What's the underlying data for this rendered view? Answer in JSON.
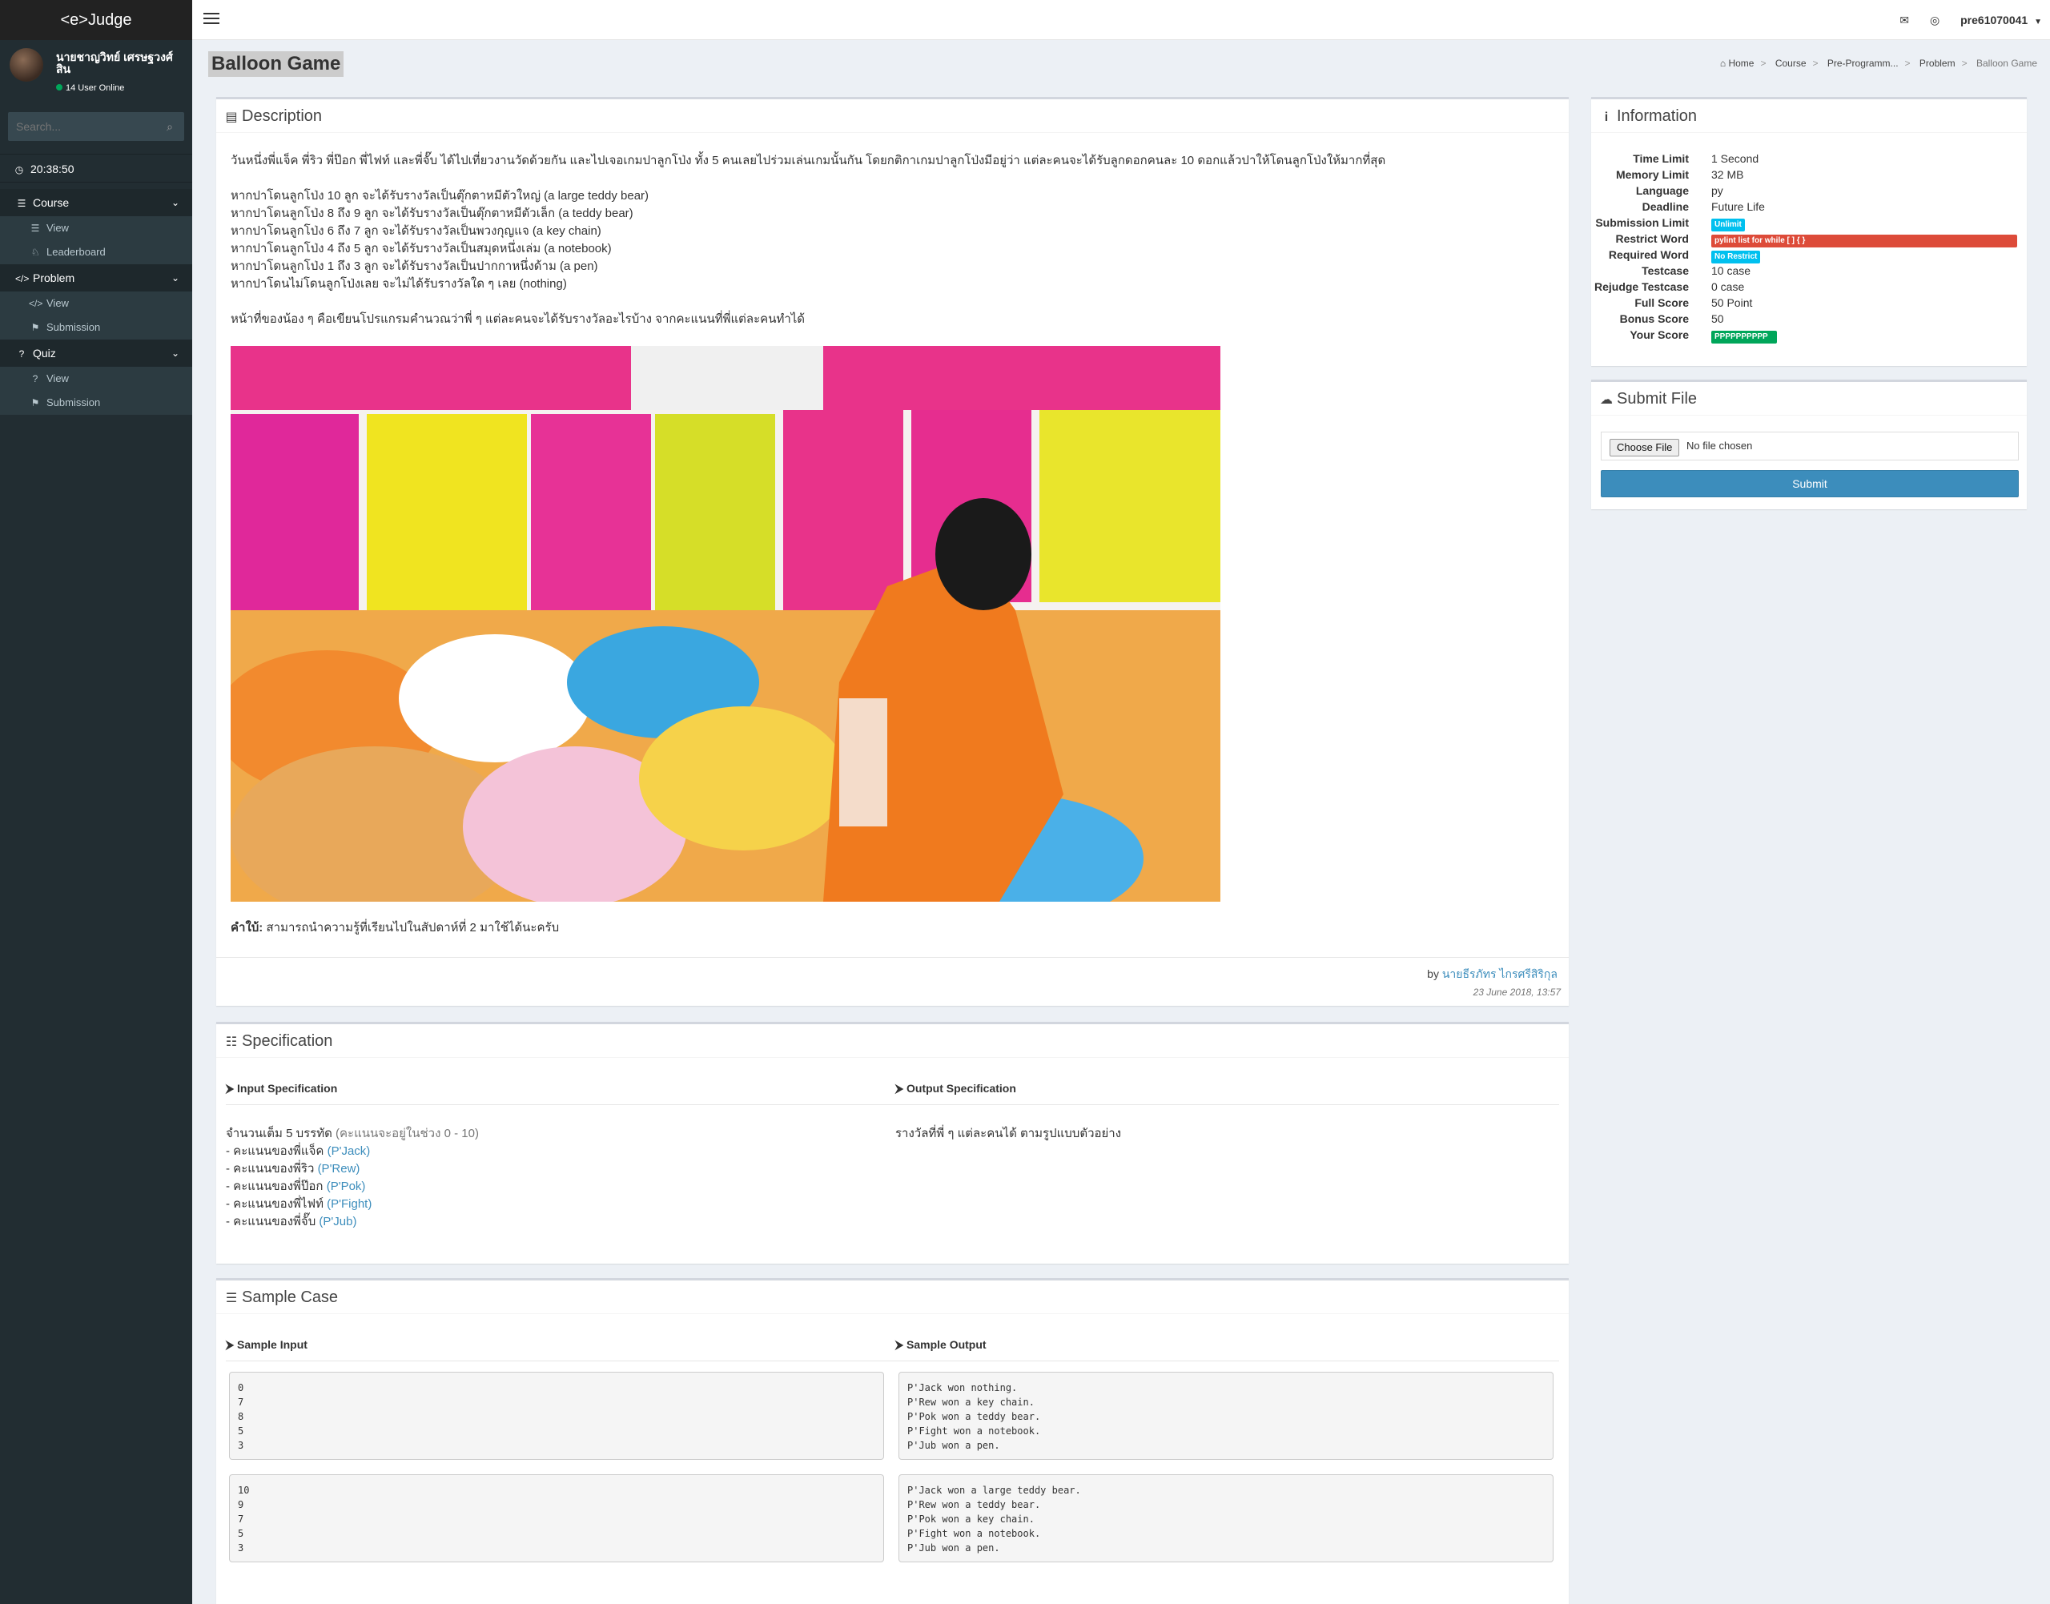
{
  "app": {
    "logo": "<e>Judge"
  },
  "user": {
    "name": "นายชาญวิทย์ เศรษฐวงศ์สิน",
    "online_text": "14 User Online"
  },
  "search": {
    "placeholder": "Search..."
  },
  "clock": "20:38:50",
  "menu": [
    {
      "label": "Course",
      "items": [
        {
          "label": "View"
        },
        {
          "label": "Leaderboard"
        }
      ]
    },
    {
      "label": "Problem",
      "items": [
        {
          "label": "View"
        },
        {
          "label": "Submission"
        }
      ]
    },
    {
      "label": "Quiz",
      "items": [
        {
          "label": "View"
        },
        {
          "label": "Submission"
        }
      ]
    }
  ],
  "topbar": {
    "username": "pre61070041"
  },
  "page": {
    "title": "Balloon Game"
  },
  "breadcrumb": [
    "Home",
    "Course",
    "Pre-Programm...",
    "Problem",
    "Balloon Game"
  ],
  "description": {
    "heading": "Description",
    "intro": "วันหนึ่งพี่แจ็ค พี่ริว พี่ป๊อก พี่ไฟท์ และพี่จั๊บ ได้ไปเที่ยวงานวัดด้วยกัน และไปเจอเกมปาลูกโป่ง ทั้ง 5 คนเลยไปร่วมเล่นเกมนั้นกัน โดยกติกาเกมปาลูกโป่งมีอยู่ว่า แต่ละคนจะได้รับลูกดอกคนละ 10 ดอกแล้วปาให้โดนลูกโป่งให้มากที่สุด",
    "rules": [
      "หากปาโดนลูกโป่ง 10 ลูก จะได้รับรางวัลเป็นตุ๊กตาหมีตัวใหญ่ (a large teddy bear)",
      "หากปาโดนลูกโป่ง 8 ถึง 9 ลูก จะได้รับรางวัลเป็นตุ๊กตาหมีตัวเล็ก (a teddy bear)",
      "หากปาโดนลูกโป่ง 6 ถึง 7 ลูก จะได้รับรางวัลเป็นพวงกุญแจ (a key chain)",
      "หากปาโดนลูกโป่ง 4 ถึง 5 ลูก จะได้รับรางวัลเป็นสมุดหนึ่งเล่ม (a notebook)",
      "หากปาโดนลูกโป่ง 1 ถึง 3 ลูก จะได้รับรางวัลเป็นปากกาหนึ่งด้าม (a pen)",
      "หากปาโดนไม่โดนลูกโป่งเลย จะไม่ได้รับรางวัลใด ๆ เลย (nothing)"
    ],
    "task": "หน้าที่ของน้อง ๆ คือเขียนโปรแกรมคำนวณว่าพี่ ๆ แต่ละคนจะได้รับรางวัลอะไรบ้าง จากคะแนนที่พี่แต่ละคนทำได้",
    "hint_label": "คำใบ้:",
    "hint": "สามารถนำความรู้ที่เรียนไปในสัปดาห์ที่ 2 มาใช้ได้นะครับ",
    "by_label": "by",
    "author": "นายธีรภัทร ไกรศรีสิริกุล",
    "date": "23 June 2018, 13:57"
  },
  "specification": {
    "heading": "Specification",
    "input_heading": "Input Specification",
    "output_heading": "Output Specification",
    "input_line": "จำนวนเต็ม 5 บรรทัด",
    "input_range": "(คะแนนจะอยู่ในช่วง 0 - 10)",
    "input_items": [
      {
        "text": "- คะแนนของพี่แจ็ค",
        "name": "(P'Jack)"
      },
      {
        "text": "- คะแนนของพี่ริว",
        "name": "(P'Rew)"
      },
      {
        "text": "- คะแนนของพี่ป๊อก",
        "name": "(P'Pok)"
      },
      {
        "text": "- คะแนนของพี่ไฟท์",
        "name": "(P'Fight)"
      },
      {
        "text": "- คะแนนของพี่จั๊บ",
        "name": "(P'Jub)"
      }
    ],
    "output_text": "รางวัลที่พี่ ๆ แต่ละคนได้ ตามรูปแบบตัวอย่าง"
  },
  "sample": {
    "heading": "Sample Case",
    "input_heading": "Sample Input",
    "output_heading": "Sample Output",
    "cases": [
      {
        "input": "0\n7\n8\n5\n3",
        "output": "P'Jack won nothing.\nP'Rew won a key chain.\nP'Pok won a teddy bear.\nP'Fight won a notebook.\nP'Jub won a pen."
      },
      {
        "input": "10\n9\n7\n5\n3",
        "output": "P'Jack won a large teddy bear.\nP'Rew won a teddy bear.\nP'Pok won a key chain.\nP'Fight won a notebook.\nP'Jub won a pen."
      }
    ]
  },
  "information": {
    "heading": "Information",
    "rows": [
      {
        "key": "Time Limit",
        "value": "1 Second"
      },
      {
        "key": "Memory Limit",
        "value": "32 MB"
      },
      {
        "key": "Language",
        "value": "py"
      },
      {
        "key": "Deadline",
        "value": "Future Life"
      },
      {
        "key": "Submission Limit",
        "badge": "Unlimit",
        "color": "#00c0ef"
      },
      {
        "key": "Restrict Word",
        "badge": "pylint list for while [ ] { }",
        "color": "#dd4b39"
      },
      {
        "key": "Required Word",
        "badge": "No Restrict",
        "color": "#00c0ef"
      },
      {
        "key": "Testcase",
        "value": "10 case"
      },
      {
        "key": "Rejudge Testcase",
        "value": "0 case"
      },
      {
        "key": "Full Score",
        "value": "50 Point"
      },
      {
        "key": "Bonus Score",
        "value": "50"
      },
      {
        "key": "Your Score",
        "badge": "PPPPPPPPPP",
        "color": "#00a65a"
      }
    ]
  },
  "submit": {
    "heading": "Submit File",
    "choose_label": "Choose File",
    "no_file": "No file chosen",
    "submit_label": "Submit"
  }
}
